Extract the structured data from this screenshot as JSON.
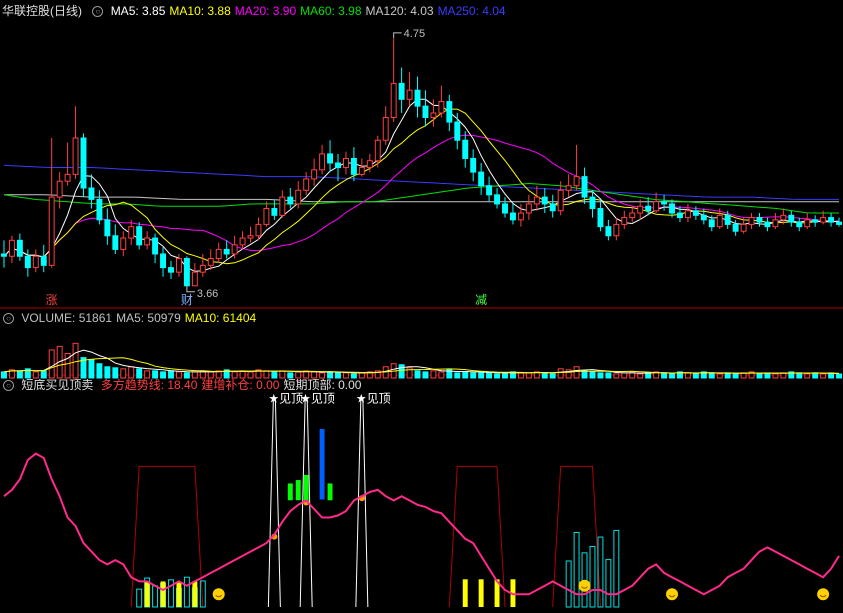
{
  "panels": {
    "price": {
      "title": "华联控股(日线)",
      "ma": [
        {
          "label": "MA5: 3.85",
          "color": "#ffffff"
        },
        {
          "label": "MA10: 3.88",
          "color": "#ffff00"
        },
        {
          "label": "MA20: 3.90",
          "color": "#ff00ff"
        },
        {
          "label": "MA60: 3.98",
          "color": "#00e000"
        },
        {
          "label": "MA120: 4.03",
          "color": "#c8c8c8"
        },
        {
          "label": "MA250: 4.04",
          "color": "#3a3aff"
        }
      ],
      "high_label": "4.75",
      "low_label": "3.66",
      "markers": [
        {
          "text": "涨",
          "color": "#ff4040",
          "x_index": 6
        },
        {
          "text": "财",
          "color": "#7fb0ff",
          "x_index": 23
        },
        {
          "text": "减",
          "color": "#40ff40",
          "x_index": 60
        }
      ]
    },
    "volume": {
      "labels": [
        {
          "label": "VOLUME: 51861",
          "color": "#c0c0c0"
        },
        {
          "label": "MA5: 50979",
          "color": "#c0c0c0"
        },
        {
          "label": "MA10: 61404",
          "color": "#ffff00"
        }
      ]
    },
    "indicator": {
      "name": "短底买见顶卖",
      "labels": [
        {
          "label": "多方趋势线: 18.40",
          "color": "#ff4040"
        },
        {
          "label": "建增补仓: 0.00",
          "color": "#ff4040"
        },
        {
          "label": "短期顶部: 0.00",
          "color": "#e0e0e0"
        }
      ],
      "top_signal_text": "★见顶"
    }
  },
  "colors": {
    "up": "#ff4040",
    "down": "#00ffff",
    "bg": "#000000",
    "divider": "#b00000"
  },
  "chart_data": {
    "type": "candlestick",
    "x_count": 106,
    "price_range": [
      3.58,
      4.82
    ],
    "candles": [
      [
        3.8,
        3.79,
        3.86,
        3.74
      ],
      [
        3.79,
        3.86,
        3.88,
        3.76
      ],
      [
        3.86,
        3.79,
        3.89,
        3.77
      ],
      [
        3.79,
        3.74,
        3.82,
        3.7
      ],
      [
        3.74,
        3.79,
        3.82,
        3.72
      ],
      [
        3.79,
        3.75,
        3.84,
        3.72
      ],
      [
        3.75,
        4.05,
        4.31,
        3.74
      ],
      [
        4.05,
        4.12,
        4.16,
        4.0
      ],
      [
        4.12,
        4.15,
        4.29,
        4.1
      ],
      [
        4.15,
        4.31,
        4.45,
        4.13
      ],
      [
        4.31,
        4.09,
        4.33,
        4.05
      ],
      [
        4.09,
        4.04,
        4.15,
        4.0
      ],
      [
        4.04,
        3.95,
        4.08,
        3.93
      ],
      [
        3.95,
        3.88,
        4.0,
        3.84
      ],
      [
        3.88,
        3.82,
        3.93,
        3.8
      ],
      [
        3.82,
        3.87,
        3.9,
        3.79
      ],
      [
        3.87,
        3.92,
        3.95,
        3.84
      ],
      [
        3.92,
        3.84,
        3.94,
        3.82
      ],
      [
        3.84,
        3.87,
        3.9,
        3.82
      ],
      [
        3.87,
        3.8,
        3.89,
        3.76
      ],
      [
        3.8,
        3.74,
        3.83,
        3.7
      ],
      [
        3.74,
        3.72,
        3.77,
        3.69
      ],
      [
        3.72,
        3.78,
        3.8,
        3.7
      ],
      [
        3.78,
        3.66,
        3.79,
        3.66
      ],
      [
        3.66,
        3.72,
        3.76,
        3.66
      ],
      [
        3.72,
        3.75,
        3.8,
        3.7
      ],
      [
        3.75,
        3.78,
        3.82,
        3.73
      ],
      [
        3.78,
        3.82,
        3.85,
        3.76
      ],
      [
        3.82,
        3.8,
        3.86,
        3.78
      ],
      [
        3.8,
        3.84,
        3.88,
        3.78
      ],
      [
        3.84,
        3.87,
        3.9,
        3.82
      ],
      [
        3.87,
        3.88,
        3.92,
        3.85
      ],
      [
        3.88,
        3.93,
        3.96,
        3.86
      ],
      [
        3.93,
        4.0,
        4.03,
        3.92
      ],
      [
        4.0,
        3.97,
        4.04,
        3.95
      ],
      [
        3.97,
        4.05,
        4.08,
        3.96
      ],
      [
        4.05,
        4.02,
        4.09,
        4.0
      ],
      [
        4.02,
        4.08,
        4.12,
        4.0
      ],
      [
        4.08,
        4.13,
        4.16,
        4.06
      ],
      [
        4.13,
        4.17,
        4.22,
        4.1
      ],
      [
        4.17,
        4.24,
        4.28,
        4.15
      ],
      [
        4.24,
        4.2,
        4.3,
        4.16
      ],
      [
        4.2,
        4.18,
        4.24,
        4.12
      ],
      [
        4.18,
        4.22,
        4.25,
        4.15
      ],
      [
        4.22,
        4.15,
        4.27,
        4.12
      ],
      [
        4.15,
        4.18,
        4.22,
        4.14
      ],
      [
        4.18,
        4.21,
        4.24,
        4.16
      ],
      [
        4.21,
        4.3,
        4.32,
        4.18
      ],
      [
        4.3,
        4.4,
        4.45,
        4.28
      ],
      [
        4.4,
        4.55,
        4.75,
        4.38
      ],
      [
        4.55,
        4.48,
        4.62,
        4.42
      ],
      [
        4.48,
        4.52,
        4.6,
        4.45
      ],
      [
        4.52,
        4.45,
        4.58,
        4.4
      ],
      [
        4.45,
        4.4,
        4.52,
        4.36
      ],
      [
        4.4,
        4.42,
        4.48,
        4.36
      ],
      [
        4.42,
        4.47,
        4.54,
        4.4
      ],
      [
        4.47,
        4.38,
        4.5,
        4.34
      ],
      [
        4.38,
        4.3,
        4.42,
        4.26
      ],
      [
        4.3,
        4.22,
        4.34,
        4.18
      ],
      [
        4.22,
        4.16,
        4.26,
        4.12
      ],
      [
        4.16,
        4.1,
        4.2,
        4.06
      ],
      [
        4.1,
        4.06,
        4.14,
        4.03
      ],
      [
        4.06,
        4.02,
        4.09,
        4.0
      ],
      [
        4.02,
        3.98,
        4.05,
        3.96
      ],
      [
        3.98,
        3.95,
        4.02,
        3.93
      ],
      [
        3.95,
        3.98,
        4.02,
        3.92
      ],
      [
        3.98,
        4.02,
        4.06,
        3.95
      ],
      [
        4.02,
        4.05,
        4.1,
        3.99
      ],
      [
        4.05,
        4.02,
        4.09,
        3.98
      ],
      [
        4.02,
        3.99,
        4.06,
        3.96
      ],
      [
        3.99,
        4.08,
        4.12,
        3.97
      ],
      [
        4.08,
        4.1,
        4.15,
        4.05
      ],
      [
        4.1,
        4.14,
        4.28,
        4.08
      ],
      [
        4.14,
        4.05,
        4.18,
        4.02
      ],
      [
        4.05,
        4.0,
        4.08,
        3.96
      ],
      [
        4.0,
        3.92,
        4.04,
        3.9
      ],
      [
        3.92,
        3.88,
        3.95,
        3.86
      ],
      [
        3.88,
        3.93,
        3.96,
        3.86
      ],
      [
        3.93,
        3.96,
        3.99,
        3.91
      ],
      [
        3.96,
        3.98,
        4.01,
        3.94
      ],
      [
        3.98,
        4.01,
        4.04,
        3.95
      ],
      [
        4.01,
        3.99,
        4.05,
        3.97
      ],
      [
        3.99,
        4.03,
        4.07,
        3.98
      ],
      [
        4.03,
        4.02,
        4.06,
        3.99
      ],
      [
        4.02,
        3.98,
        4.04,
        3.96
      ],
      [
        3.98,
        3.96,
        4.01,
        3.94
      ],
      [
        3.96,
        3.99,
        4.02,
        3.94
      ],
      [
        3.99,
        3.97,
        4.01,
        3.95
      ],
      [
        3.97,
        3.95,
        4.0,
        3.93
      ],
      [
        3.95,
        3.92,
        3.97,
        3.9
      ],
      [
        3.92,
        3.97,
        4.0,
        3.91
      ],
      [
        3.97,
        3.93,
        3.99,
        3.91
      ],
      [
        3.93,
        3.9,
        3.95,
        3.88
      ],
      [
        3.9,
        3.93,
        3.96,
        3.89
      ],
      [
        3.93,
        3.96,
        3.98,
        3.91
      ],
      [
        3.96,
        3.94,
        3.98,
        3.92
      ],
      [
        3.94,
        3.92,
        3.96,
        3.9
      ],
      [
        3.92,
        3.95,
        3.98,
        3.91
      ],
      [
        3.95,
        3.97,
        4.0,
        3.93
      ],
      [
        3.97,
        3.94,
        3.99,
        3.92
      ],
      [
        3.94,
        3.92,
        3.96,
        3.9
      ],
      [
        3.92,
        3.95,
        3.98,
        3.91
      ],
      [
        3.95,
        3.94,
        3.97,
        3.92
      ],
      [
        3.94,
        3.96,
        3.99,
        3.93
      ],
      [
        3.96,
        3.94,
        3.98,
        3.92
      ],
      [
        3.94,
        3.93,
        3.96,
        3.92
      ]
    ],
    "ma_lines": [
      {
        "name": "MA5",
        "color": "#ffffff"
      },
      {
        "name": "MA10",
        "color": "#ffff00"
      },
      {
        "name": "MA20",
        "color": "#ff00ff"
      },
      {
        "name": "MA60",
        "color": "#00e000"
      },
      {
        "name": "MA120",
        "color": "#c8c8c8"
      },
      {
        "name": "MA250",
        "color": "#3a3aff"
      }
    ],
    "ma120_values": [
      4.06,
      4.06,
      4.05,
      4.05,
      4.04,
      4.04,
      4.04,
      4.03,
      4.03,
      4.03,
      4.03,
      4.03,
      4.03,
      4.03,
      4.03,
      4.03,
      4.03,
      4.03,
      4.03,
      4.03
    ],
    "ma250_values": [
      4.19,
      4.18,
      4.18,
      4.17,
      4.16,
      4.15,
      4.14,
      4.14,
      4.13,
      4.12,
      4.11,
      4.1,
      4.09,
      4.08,
      4.07,
      4.06,
      4.05,
      4.05,
      4.04,
      4.04
    ],
    "ma60_values": [
      4.06,
      4.04,
      4.03,
      4.02,
      4.02,
      4.01,
      4.01,
      4.01,
      4.02,
      4.02,
      4.02,
      4.03,
      4.03,
      4.05,
      4.07,
      4.09,
      4.1,
      4.11,
      4.1,
      4.08,
      4.06,
      4.04,
      4.03,
      4.02,
      4.01,
      4.0,
      3.98,
      3.98
    ],
    "volume_max": 100,
    "volumes": [
      12,
      16,
      14,
      18,
      12,
      14,
      55,
      62,
      48,
      68,
      40,
      36,
      28,
      22,
      20,
      18,
      22,
      18,
      14,
      14,
      12,
      14,
      12,
      10,
      12,
      14,
      12,
      14,
      16,
      12,
      14,
      12,
      16,
      14,
      12,
      14,
      10,
      12,
      14,
      12,
      10,
      12,
      10,
      10,
      8,
      10,
      12,
      14,
      22,
      28,
      26,
      20,
      14,
      12,
      14,
      12,
      16,
      10,
      12,
      10,
      12,
      10,
      8,
      10,
      12,
      10,
      10,
      12,
      10,
      8,
      18,
      16,
      22,
      14,
      12,
      10,
      10,
      8,
      10,
      12,
      8,
      10,
      12,
      10,
      8,
      12,
      10,
      8,
      12,
      10,
      8,
      10,
      8,
      10,
      12,
      8,
      10,
      8,
      10,
      12,
      10,
      8,
      10,
      8,
      10,
      8
    ],
    "indicator": {
      "range": [
        0,
        100
      ],
      "trend_line": [
        52,
        55,
        60,
        69,
        72,
        70,
        60,
        52,
        42,
        38,
        30,
        26,
        22,
        20,
        22,
        20,
        14,
        12,
        12,
        10,
        8,
        10,
        12,
        10,
        12,
        14,
        16,
        18,
        20,
        22,
        24,
        26,
        28,
        30,
        34,
        40,
        45,
        48,
        50,
        46,
        42,
        42,
        43,
        45,
        50,
        52,
        54,
        55,
        52,
        50,
        52,
        50,
        48,
        47,
        45,
        44,
        40,
        36,
        32,
        30,
        24,
        18,
        12,
        8,
        6,
        6,
        6,
        8,
        10,
        12,
        10,
        8,
        6,
        6,
        8,
        8,
        6,
        6,
        8,
        10,
        14,
        18,
        20,
        16,
        14,
        12,
        10,
        8,
        6,
        8,
        10,
        14,
        16,
        18,
        22,
        26,
        28,
        26,
        24,
        22,
        20,
        18,
        16,
        14,
        18,
        24,
        28,
        30,
        30,
        28
      ],
      "red_envelope": [
        {
          "start": 17,
          "end": 24,
          "peak": 66
        },
        {
          "start": 57,
          "end": 62,
          "peak": 66
        },
        {
          "start": 70,
          "end": 74,
          "peak": 66
        }
      ],
      "white_spikes": [
        {
          "x": 34,
          "peak": 98
        },
        {
          "x": 38,
          "peak": 98
        },
        {
          "x": 45,
          "peak": 98
        }
      ],
      "yellow_columns": [
        {
          "start": 18,
          "end": 24,
          "height": 12
        },
        {
          "start": 58,
          "end": 65,
          "height": 13
        }
      ],
      "cyan_steps": [
        {
          "start": 17,
          "end": 25,
          "height": 14
        },
        {
          "start": 71,
          "end": 77,
          "height": 36
        }
      ]
    }
  }
}
